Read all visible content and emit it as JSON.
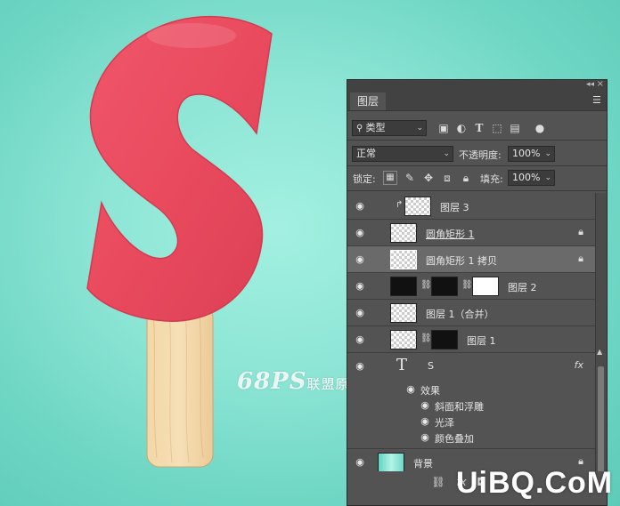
{
  "watermark": {
    "brand": "68PS",
    "text": "联盟原创"
  },
  "logo": {
    "text": "UiBQ.CoM"
  },
  "panel": {
    "tab": "图层",
    "filter_kind": "类型",
    "blend_mode": "正常",
    "opacity_label": "不透明度:",
    "opacity_value": "100%",
    "lock_label": "锁定:",
    "fill_label": "填充:",
    "fill_value": "100%"
  },
  "layers": [
    {
      "name": "图层 3"
    },
    {
      "name": "圆角矩形 1"
    },
    {
      "name": "圆角矩形 1 拷贝"
    },
    {
      "name": "图层 2"
    },
    {
      "name": "图层 1（合并）"
    },
    {
      "name": "图层 1"
    },
    {
      "name": "S"
    },
    {
      "name": "效果"
    },
    {
      "name": "斜面和浮雕"
    },
    {
      "name": "光泽"
    },
    {
      "name": "颜色叠加"
    },
    {
      "name": "背景"
    }
  ],
  "bottom": {
    "fx": "fx"
  },
  "colors": {
    "canvas": "#8fe6d6",
    "letter": "#e84a5f",
    "stick": "#f2d9ad",
    "panel": "#535353",
    "selected_row": "#6a6a6a"
  },
  "icons": [
    "eye-icon",
    "lock-icon",
    "link-icon",
    "menu-icon",
    "fx-icon",
    "text-layer-icon"
  ]
}
